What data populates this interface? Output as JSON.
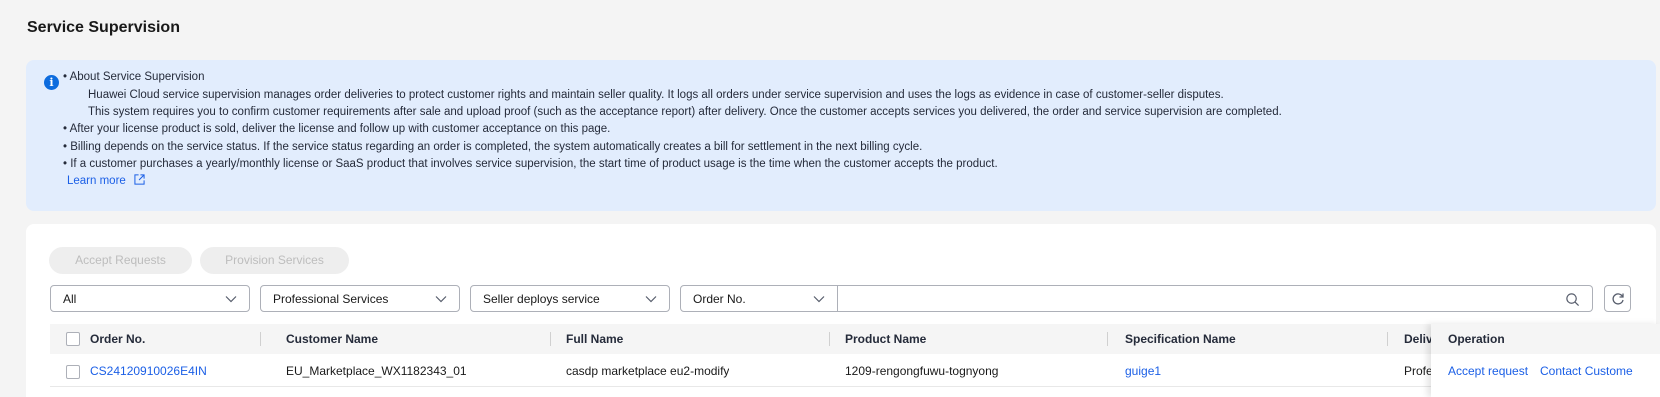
{
  "page": {
    "title": "Service Supervision"
  },
  "notice": {
    "heading": "• About Service Supervision",
    "para1": "Huawei Cloud service supervision manages order deliveries to protect customer rights and maintain seller quality. It logs all orders under service supervision and uses the logs as evidence in case of customer-seller disputes.",
    "para2": "This system requires you to confirm customer requirements after sale and upload proof (such as the acceptance report) after delivery. Once the customer accepts services you delivered, the order and service supervision are completed.",
    "bullet1": "• After your license product is sold, deliver the license and follow up with customer acceptance on this page.",
    "bullet2": "• Billing depends on the service status. If the service status regarding an order is completed, the system automatically creates a bill for settlement in the next billing cycle.",
    "bullet3": "• If a customer purchases a yearly/monthly license or SaaS product that involves service supervision, the start time of product usage is the time when the customer accepts the product.",
    "learn_more": "Learn more"
  },
  "actions": {
    "accept_requests": "Accept Requests",
    "provision_services": "Provision Services"
  },
  "filters": {
    "status": "All",
    "service_type": "Professional Services",
    "deploy_mode": "Seller deploys service",
    "search_field": "Order No.",
    "search_value": ""
  },
  "table": {
    "columns": {
      "order_no": "Order No.",
      "customer_name": "Customer Name",
      "full_name": "Full Name",
      "product_name": "Product Name",
      "spec_name": "Specification Name",
      "delivery": "Deliv",
      "operation": "Operation"
    },
    "rows": [
      {
        "order_no": "CS24120910026E4IN",
        "customer_name": "EU_Marketplace_WX1182343_01",
        "full_name": "casdp marketplace eu2-modify",
        "product_name": "1209-rengongfuwu-tognyong",
        "spec_name": "guige1",
        "delivery": "Profe",
        "op_accept": "Accept request",
        "op_contact": "Contact Custome"
      }
    ]
  },
  "colors": {
    "accent": "#1b5fe6",
    "notice_bg": "#e2edfd",
    "info_icon": "#0d6cde"
  }
}
